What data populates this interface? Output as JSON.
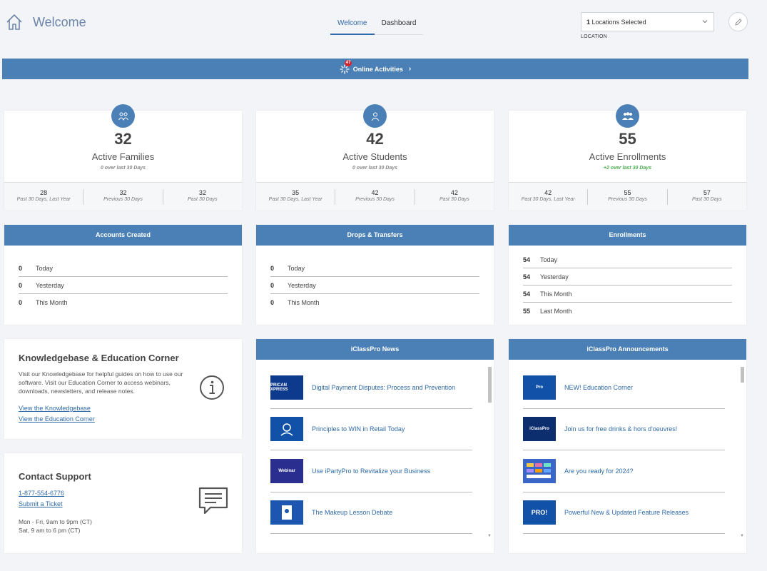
{
  "header": {
    "title": "Welcome",
    "tabs": [
      {
        "label": "Welcome",
        "active": true
      },
      {
        "label": "Dashboard",
        "active": false
      }
    ],
    "location": {
      "count": "1",
      "text": "Locations Selected",
      "label": "LOCATION"
    }
  },
  "activity_bar": {
    "badge": "47",
    "label": "Online Activities"
  },
  "stats": [
    {
      "icon": "families-icon",
      "value": "32",
      "label": "Active Families",
      "sub": "0 over last 30 Days",
      "footer": [
        {
          "num": "28",
          "cap": "Past 30 Days, Last Year"
        },
        {
          "num": "32",
          "cap": "Previous 30 Days"
        },
        {
          "num": "32",
          "cap": "Past 30 Days"
        }
      ]
    },
    {
      "icon": "student-icon",
      "value": "42",
      "label": "Active Students",
      "sub": "0 over last 30 Days",
      "footer": [
        {
          "num": "35",
          "cap": "Past 30 Days, Last Year"
        },
        {
          "num": "42",
          "cap": "Previous 30 Days"
        },
        {
          "num": "42",
          "cap": "Past 30 Days"
        }
      ]
    },
    {
      "icon": "enrollments-icon",
      "value": "55",
      "label": "Active Enrollments",
      "sub": "+2 over last 30 Days",
      "sub_color": "#4caf50",
      "footer": [
        {
          "num": "42",
          "cap": "Past 30 Days, Last Year"
        },
        {
          "num": "55",
          "cap": "Previous 30 Days"
        },
        {
          "num": "57",
          "cap": "Past 30 Days"
        }
      ]
    }
  ],
  "lists": [
    {
      "title": "Accounts Created",
      "rows": [
        {
          "num": "0",
          "label": "Today"
        },
        {
          "num": "0",
          "label": "Yesterday"
        },
        {
          "num": "0",
          "label": "This Month"
        }
      ]
    },
    {
      "title": "Drops & Transfers",
      "rows": [
        {
          "num": "0",
          "label": "Today"
        },
        {
          "num": "0",
          "label": "Yesterday"
        },
        {
          "num": "0",
          "label": "This Month"
        }
      ]
    },
    {
      "title": "Enrollments",
      "rows": [
        {
          "num": "54",
          "label": "Today"
        },
        {
          "num": "54",
          "label": "Yesterday"
        },
        {
          "num": "54",
          "label": "This Month"
        },
        {
          "num": "55",
          "label": "Last Month"
        }
      ]
    }
  ],
  "knowledgebase": {
    "title": "Knowledgebase & Education Corner",
    "text": "Visit our Knowledgebase for helpful guides on how to use our software. Visit our Education Corner to access webinars, downloads, newsletters, and release notes.",
    "link1": "View the Knowledgebase",
    "link2": "View the Education Corner"
  },
  "support": {
    "title": "Contact Support",
    "phone": "1-877-554-6776",
    "ticket": "Submit a Ticket",
    "hours1": "Mon - Fri, 9am to 9pm (CT)",
    "hours2": "Sat, 9 am to 6 pm (CT)"
  },
  "news": {
    "title": "iClassPro News",
    "items": [
      {
        "title": "Digital Payment Disputes: Process and Prevention",
        "thumb_text": "PRICAN XPRESS"
      },
      {
        "title": "Principles to WIN in Retail Today",
        "thumb_text": ""
      },
      {
        "title": "Use iPartyPro to Revitalize your Business",
        "thumb_text": "Webinar"
      },
      {
        "title": "The Makeup Lesson Debate",
        "thumb_text": ""
      }
    ]
  },
  "announcements": {
    "title": "iClassPro Announcements",
    "items": [
      {
        "title": "NEW! Education Corner",
        "thumb_text": "Pro"
      },
      {
        "title": "Join us for free drinks & hors d'oeuvres!",
        "thumb_text": "iClassPro"
      },
      {
        "title": "Are you ready for 2024?",
        "thumb_text": ""
      },
      {
        "title": "Powerful New & Updated Feature Releases",
        "thumb_text": "PRO!"
      }
    ]
  },
  "colors": {
    "primary": "#4b80b7",
    "link": "#2f6aa7",
    "badge": "#d2262e",
    "positive": "#4caf50",
    "background": "#f3f4f8"
  }
}
